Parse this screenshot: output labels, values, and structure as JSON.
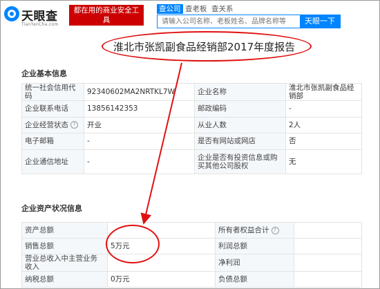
{
  "header": {
    "logo_text": "天眼查",
    "logo_sub": "TianYanCha.com",
    "slogan": "都在用的商业安全工具",
    "tabs": [
      "查公司",
      "查老板",
      "查关系"
    ],
    "search_placeholder": "请输入公司名称、老板姓名、品牌名称等",
    "search_button": "天眼一下"
  },
  "report": {
    "title": "淮北市张凯副食品经销部2017年度报告"
  },
  "basic_info": {
    "section_title": "企业基本信息",
    "rows": [
      {
        "l1": "统一社会信用代码",
        "v1": "92340602MA2NRTKL7W",
        "l2": "企业名称",
        "v2": "淮北市张凯副食品经销部"
      },
      {
        "l1": "企业联系电话",
        "v1": "13856142353",
        "l2": "邮政编码",
        "v2": "-"
      },
      {
        "l1": "企业经营状态",
        "v1": "开业",
        "l2": "从业人数",
        "v2": "2人"
      },
      {
        "l1": "电子邮箱",
        "v1": "-",
        "l2": "是否有网站或网店",
        "v2": "否"
      },
      {
        "l1": "企业通信地址",
        "v1": "-",
        "l2": "企业是否有投资信息或购买其他公司股权",
        "v2": "无"
      }
    ]
  },
  "assets": {
    "section_title": "企业资产状况信息",
    "rows": [
      {
        "l1": "资产总额",
        "v1": "",
        "l2": "所有者权益合计",
        "v2": ""
      },
      {
        "l1": "销售总额",
        "v1": "5万元",
        "l2": "利润总额",
        "v2": ""
      },
      {
        "l1": "营业总收入中主营业务收入",
        "v1": "",
        "l2": "净利润",
        "v2": ""
      },
      {
        "l1": "纳税总额",
        "v1": "0万元",
        "l2": "负债总额",
        "v2": ""
      }
    ]
  },
  "colors": {
    "brand_blue": "#0084ff",
    "annotation_red": "#e01010",
    "slogan_red": "#cc0000"
  }
}
